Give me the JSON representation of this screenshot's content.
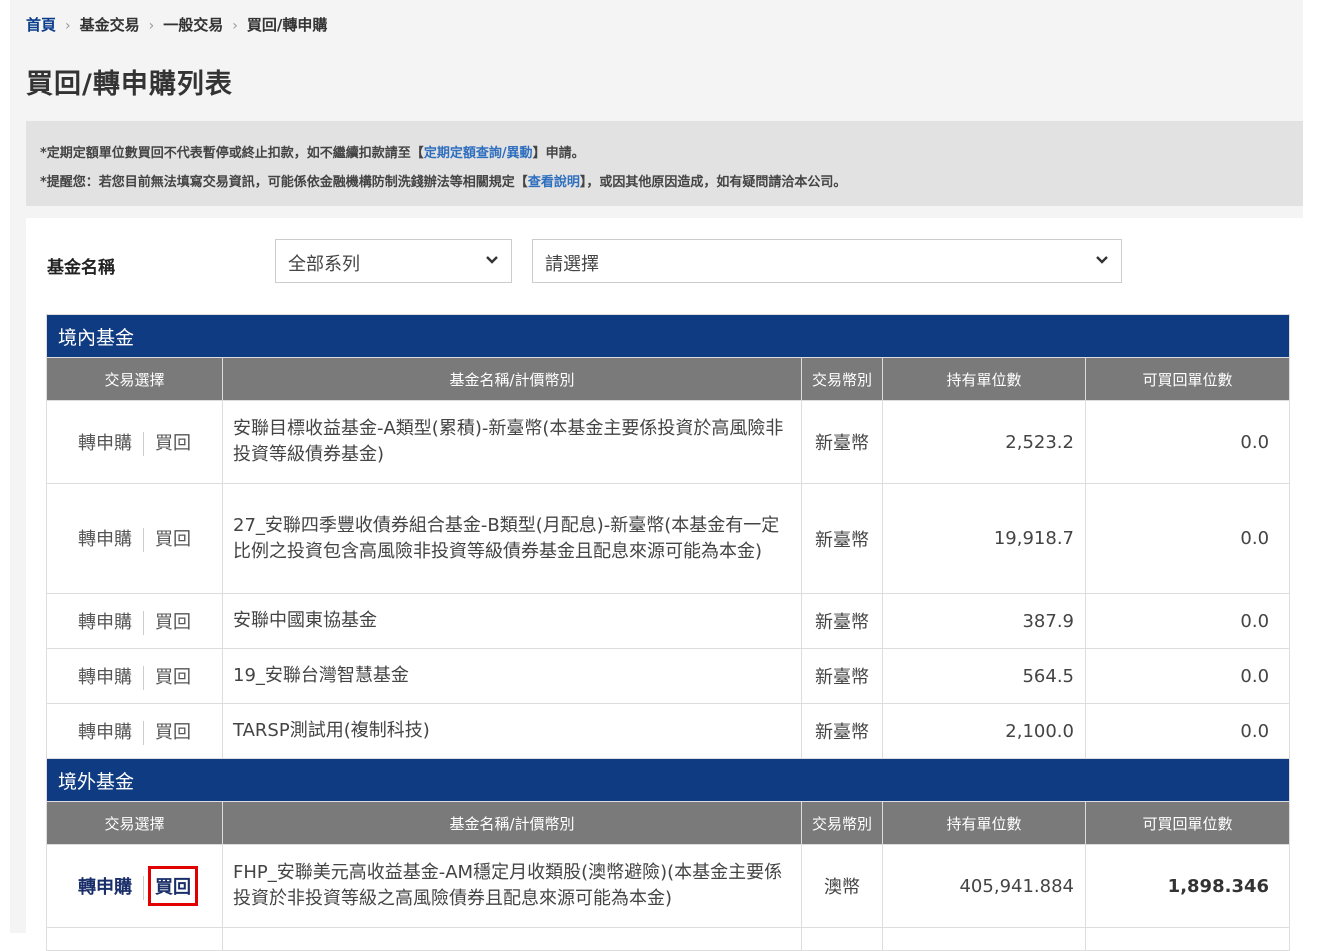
{
  "breadcrumb": [
    "首頁",
    "基金交易",
    "一般交易",
    "買回/轉申購"
  ],
  "page_title": "買回/轉申購列表",
  "notice": {
    "line1_pre": "*定期定額單位數買回不代表暫停或終止扣款，如不繼續扣款請至【",
    "line1_link": "定期定額查詢/異動",
    "line1_post": "】申請。",
    "line2_pre": "*提醒您：若您目前無法填寫交易資訊，可能係依金融機構防制洗錢辦法等相關規定【",
    "line2_link": "查看說明",
    "line2_post": "】，或因其他原因造成，如有疑問請洽本公司。"
  },
  "filter": {
    "label": "基金名稱",
    "series_value": "全部系列",
    "fund_value": "請選擇"
  },
  "columns": [
    "交易選擇",
    "基金名稱/計價幣別",
    "交易幣別",
    "持有單位數",
    "可買回單位數"
  ],
  "actions": {
    "switch": "轉申購",
    "redeem": "買回"
  },
  "domestic": {
    "title": "境內基金",
    "rows": [
      {
        "name": "安聯目標收益基金-A類型(累積)-新臺幣(本基金主要係投資於高風險非投資等級債券基金)",
        "currency": "新臺幣",
        "units": "2,523.2",
        "redeemable": "0.0"
      },
      {
        "name": "27_安聯四季豐收債券組合基金-B類型(月配息)-新臺幣(本基金有一定比例之投資包含高風險非投資等級債券基金且配息來源可能為本金)",
        "currency": "新臺幣",
        "units": "19,918.7",
        "redeemable": "0.0"
      },
      {
        "name": "安聯中國東協基金",
        "currency": "新臺幣",
        "units": "387.9",
        "redeemable": "0.0"
      },
      {
        "name": "19_安聯台灣智慧基金",
        "currency": "新臺幣",
        "units": "564.5",
        "redeemable": "0.0"
      },
      {
        "name": "TARSP測試用(複制科技)",
        "currency": "新臺幣",
        "units": "2,100.0",
        "redeemable": "0.0"
      }
    ]
  },
  "overseas": {
    "title": "境外基金",
    "rows": [
      {
        "name": "FHP_安聯美元高收益基金-AM穩定月收類股(澳幣避險)(本基金主要係投資於非投資等級之高風險債券且配息來源可能為本金)",
        "currency": "澳幣",
        "units": "405,941.884",
        "redeemable": "1,898.346"
      }
    ]
  },
  "colors": {
    "section_header": "#0f3b82",
    "column_header": "#7a7a7a",
    "link": "#2f6fbf",
    "highlight": "#e00000"
  }
}
